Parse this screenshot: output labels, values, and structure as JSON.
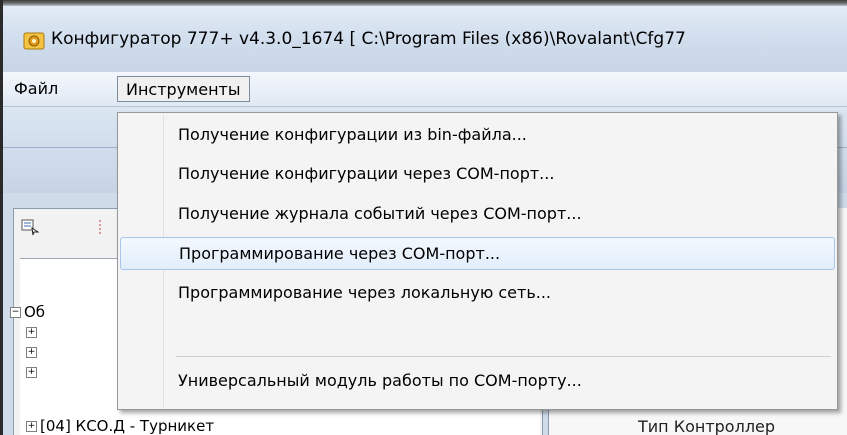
{
  "window": {
    "title": "Конфигуратор 777+ v4.3.0_1674 [ C:\\Program Files (x86)\\Rovalant\\Cfg77"
  },
  "menubar": {
    "items": [
      {
        "label": "Файл"
      },
      {
        "label": "Инструменты"
      }
    ]
  },
  "tools_menu": {
    "items": [
      {
        "label": "Получение конфигурации из bin-файла..."
      },
      {
        "label": "Получение конфигурации через COM-порт..."
      },
      {
        "label": "Получение журнала событий через COM-порт..."
      },
      {
        "label": "Программирование через COM-порт..."
      },
      {
        "label": "Программирование через локальную сеть..."
      },
      {
        "label": "Универсальный модуль работы по COM-порту..."
      }
    ],
    "highlighted_index": 3
  },
  "tree": {
    "root_label": "Об",
    "visible_item": "[04] КСО.Д - Турникет"
  },
  "right_panel": {
    "partial_label": "Тип Контроллер"
  },
  "colors": {
    "menu_highlight_border": "#a7c6ea",
    "menu_background": "#f4f4f4"
  }
}
